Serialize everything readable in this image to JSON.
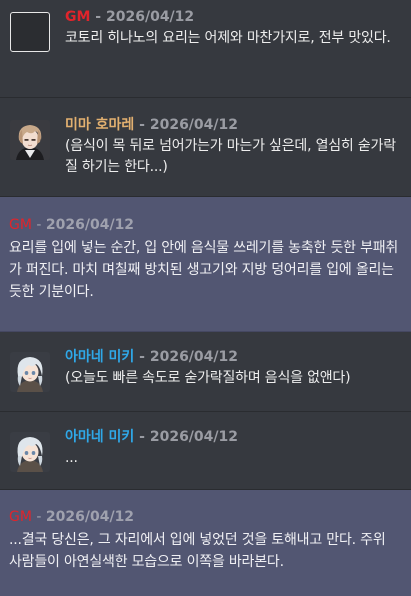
{
  "colors": {
    "gm": "#e0242b",
    "mima": "#e2b070",
    "amane": "#2fa8e8"
  },
  "messages": [
    {
      "author": "GM",
      "separator": " - ",
      "timestamp": "2026/04/12",
      "text": "코토리 히나노의 요리는 어제와 마찬가지로, 전부 맛있다.",
      "avatar_icon": "empty-avatar-icon"
    },
    {
      "author": "미마 호마레",
      "separator": " - ",
      "timestamp": "2026/04/12",
      "text": "(음식이 목 뒤로 넘어가는가 마는가 싶은데, 열심히 숟가락질 하기는 한다...)",
      "avatar_icon": "brown-hair-avatar-icon"
    },
    {
      "author": "GM",
      "separator": " - ",
      "timestamp": "2026/04/12",
      "text": "요리를 입에 넣는 순간, 입 안에 음식물 쓰레기를 농축한 듯한 부패취가 퍼진다. 마치 며칠째 방치된 생고기와 지방 덩어리를 입에 올리는 듯한 기분이다."
    },
    {
      "author": "아마네 미키",
      "separator": " - ",
      "timestamp": "2026/04/12",
      "text": "(오늘도 빠른 속도로 숟가락질하며 음식을 없앤다)",
      "avatar_icon": "white-hair-avatar-icon"
    },
    {
      "author": "아마네 미키",
      "separator": " - ",
      "timestamp": "2026/04/12",
      "text": "...",
      "avatar_icon": "white-hair-avatar-icon"
    },
    {
      "author": "GM",
      "separator": " - ",
      "timestamp": "2026/04/12",
      "text": "...결국 당신은, 그 자리에서 입에 넣었던 것을 토해내고 만다. 주위 사람들이 아연실색한 모습으로 이쪽을 바라본다."
    }
  ]
}
